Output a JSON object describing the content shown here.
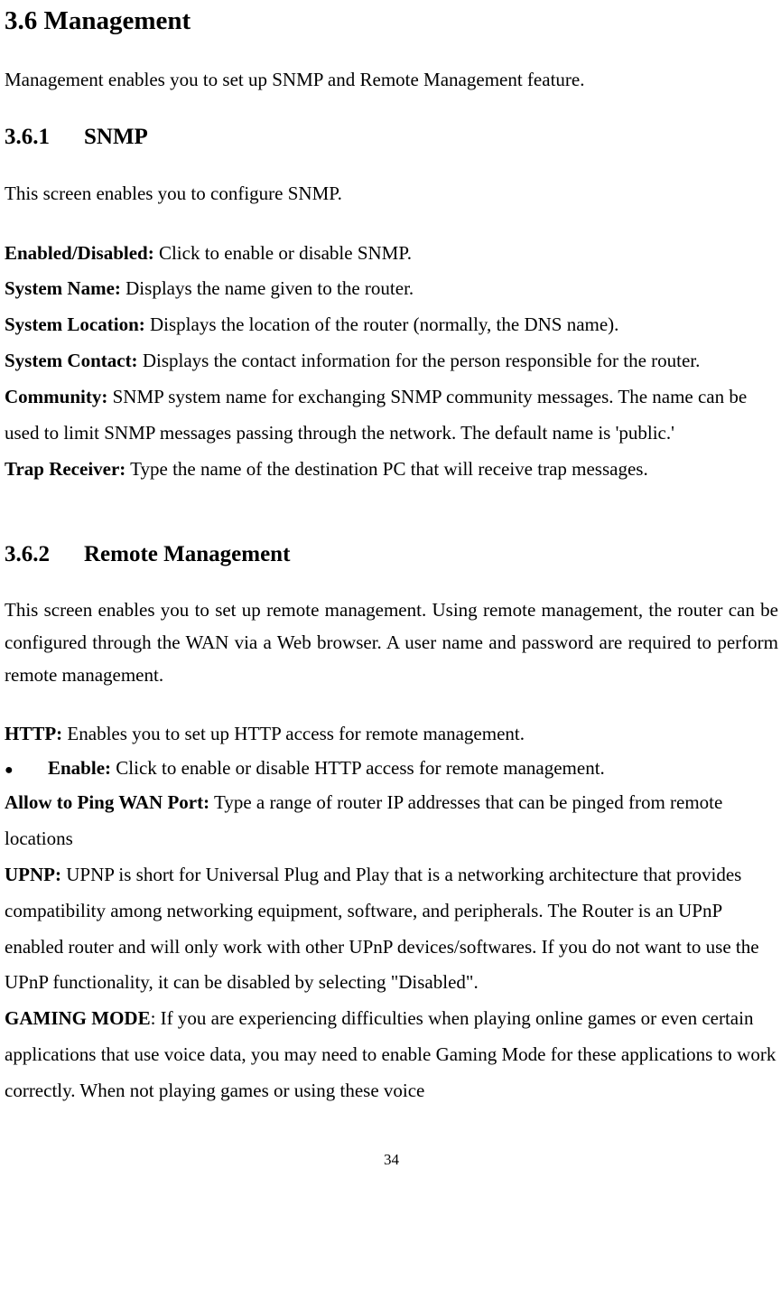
{
  "section_main": {
    "number": "3.6",
    "title": "Management",
    "intro": "Management enables you to set up SNMP and Remote Management feature."
  },
  "section_snmp": {
    "number": "3.6.1",
    "title": "SNMP",
    "intro": "This screen enables you to configure SNMP.",
    "definitions": [
      {
        "label": "Enabled/Disabled:",
        "text": " Click to enable or disable SNMP."
      },
      {
        "label": "System Name:",
        "text": " Displays the name given to the router."
      },
      {
        "label": "System Location:",
        "text": " Displays the location of the router (normally, the DNS name)."
      },
      {
        "label": "System Contact:",
        "text": " Displays the contact information for the person responsible for the router."
      },
      {
        "label": "Community:",
        "text": " SNMP system name for exchanging SNMP community messages. The name can be used to limit SNMP messages passing through the network. The default name is 'public.'"
      },
      {
        "label": "Trap Receiver:",
        "text": " Type the name of the destination PC that will receive trap messages."
      }
    ]
  },
  "section_remote": {
    "number": "3.6.2",
    "title": "Remote Management",
    "intro": "This screen enables you to set up remote management. Using remote management, the router can be configured through the WAN via a Web browser. A user name and password are required to perform remote management.",
    "http": {
      "label": "HTTP:",
      "text": " Enables you to set up HTTP access for remote management."
    },
    "bullet_enable": {
      "label": "Enable:",
      "text": " Click to enable or disable HTTP access for remote management."
    },
    "ping": {
      "label": "Allow to Ping WAN Port:",
      "text": " Type a range of router IP addresses that can be pinged from remote locations"
    },
    "upnp": {
      "label": "UPNP:",
      "text": " UPNP is short for Universal Plug and Play that is a networking architecture that provides compatibility among networking equipment, software, and peripherals. The Router is an UPnP enabled router and will only work with other UPnP devices/softwares. If you do not want to use the UPnP functionality, it can be disabled by selecting \"Disabled\"."
    },
    "gaming": {
      "label": "GAMING MODE",
      "text": ": If you are experiencing difficulties when playing online games or even certain applications that use voice data, you may need to enable Gaming Mode for these applications to work correctly. When not playing games or using these voice"
    }
  },
  "page_number": "34"
}
